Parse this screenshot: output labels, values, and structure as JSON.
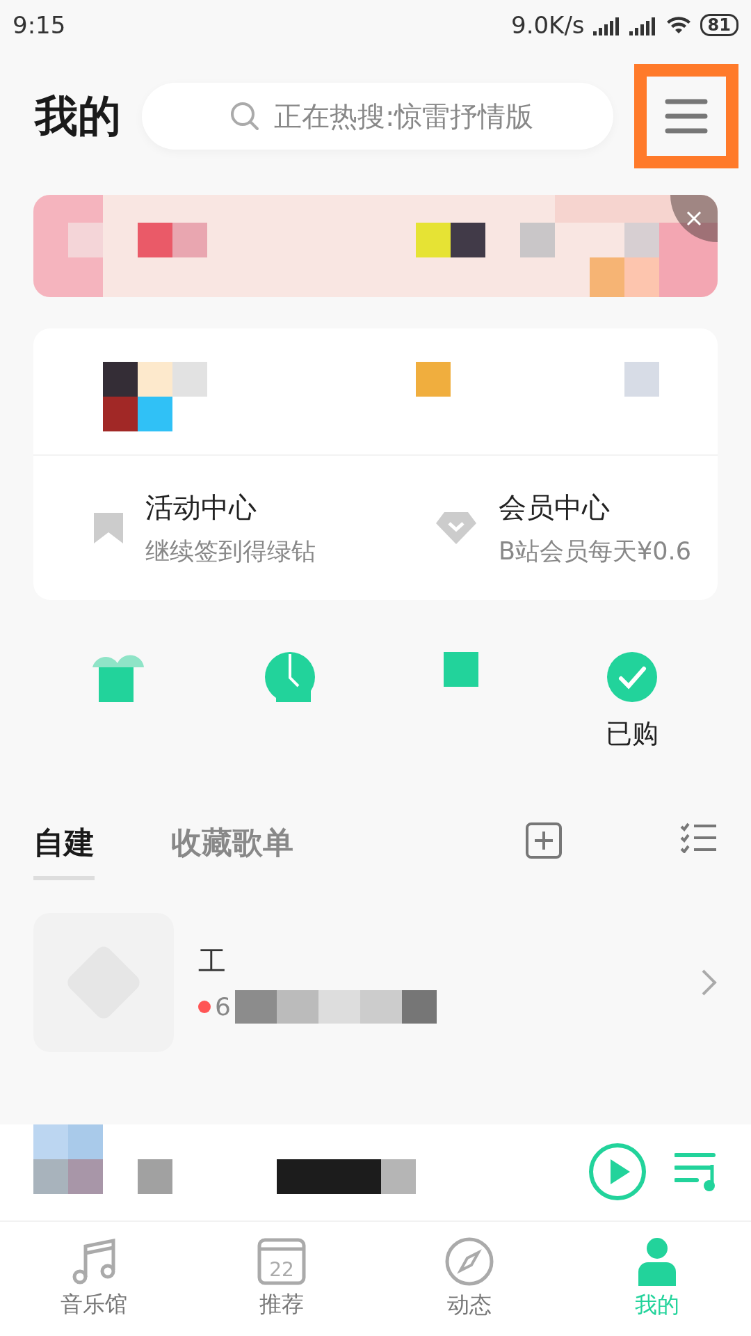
{
  "status_bar": {
    "time": "9:15",
    "net_speed": "9.0K/s",
    "battery": "81"
  },
  "header": {
    "title": "我的",
    "search": {
      "placeholder": "正在热搜:惊雷抒情版"
    },
    "menu_button": {
      "highlighted": true
    }
  },
  "account_card": {
    "entries": [
      {
        "kind": "bookmark",
        "title": "活动中心",
        "subtitle": "继续签到得绿钻"
      },
      {
        "kind": "diamond",
        "title": "会员中心",
        "subtitle": "B站会员每天¥0.6"
      }
    ]
  },
  "quick_items": [
    {
      "kind": "gift"
    },
    {
      "kind": "clock"
    },
    {
      "kind": "square"
    },
    {
      "kind": "check",
      "label": "已购"
    }
  ],
  "playlist_tabs": [
    {
      "label": "自建",
      "selected": true
    },
    {
      "label": "收藏歌单",
      "selected": false
    }
  ],
  "playlists": [
    {
      "title": "工",
      "count": "6"
    }
  ],
  "bottom_nav": [
    {
      "kind": "music",
      "label": "音乐馆",
      "selected": false
    },
    {
      "kind": "calendar",
      "label": "推荐",
      "icon_text": "22",
      "selected": false
    },
    {
      "kind": "compass",
      "label": "动态",
      "selected": false
    },
    {
      "kind": "person",
      "label": "我的",
      "selected": true
    }
  ]
}
